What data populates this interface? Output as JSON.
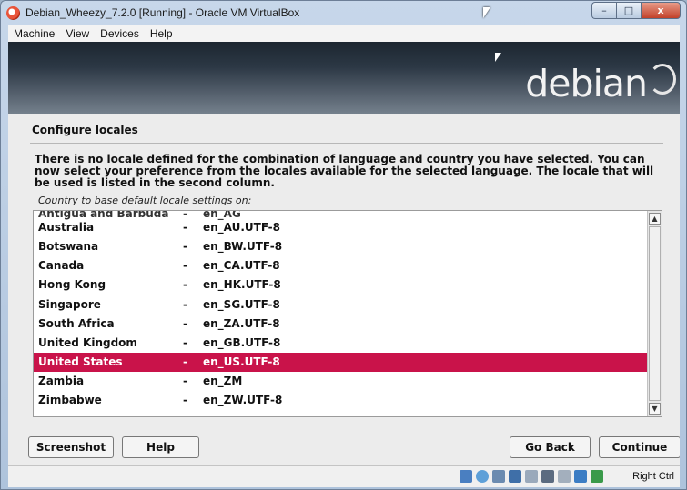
{
  "window": {
    "title": "Debian_Wheezy_7.2.0 [Running] - Oracle VM VirtualBox",
    "controls": {
      "minimize": "–",
      "maximize": "□",
      "close": "x"
    }
  },
  "menubar": [
    "Machine",
    "View",
    "Devices",
    "Help"
  ],
  "installer": {
    "brand": "debian",
    "section_title": "Configure locales",
    "description": "There is no locale defined for the combination of language and country you have selected. You can now select your preference from the locales available for the selected language. The locale that will be used is listed in the second column.",
    "prompt": "Country to base default locale settings on:",
    "partial_row": {
      "country": "Antigua and Barbuda",
      "dash": "-",
      "locale": "en_AG"
    },
    "rows": [
      {
        "country": "Australia",
        "dash": "-",
        "locale": "en_AU.UTF-8"
      },
      {
        "country": "Botswana",
        "dash": "-",
        "locale": "en_BW.UTF-8"
      },
      {
        "country": "Canada",
        "dash": "-",
        "locale": "en_CA.UTF-8"
      },
      {
        "country": "Hong Kong",
        "dash": "-",
        "locale": "en_HK.UTF-8"
      },
      {
        "country": "Singapore",
        "dash": "-",
        "locale": "en_SG.UTF-8"
      },
      {
        "country": "South Africa",
        "dash": "-",
        "locale": "en_ZA.UTF-8"
      },
      {
        "country": "United Kingdom",
        "dash": "-",
        "locale": "en_GB.UTF-8"
      },
      {
        "country": "United States",
        "dash": "-",
        "locale": "en_US.UTF-8",
        "selected": true
      },
      {
        "country": "Zambia",
        "dash": "-",
        "locale": "en_ZM"
      },
      {
        "country": "Zimbabwe",
        "dash": "-",
        "locale": "en_ZW.UTF-8"
      }
    ],
    "scroll_up": "▲",
    "scroll_down": "▼",
    "buttons": {
      "screenshot": "Screenshot",
      "help": "Help",
      "go_back": "Go Back",
      "continue": "Continue"
    },
    "selection_color": "#c9134a"
  },
  "statusbar": {
    "icons": [
      "hard-disk-icon",
      "optical-drive-icon",
      "usb-icon",
      "network-icon",
      "shared-folders-icon",
      "display-icon",
      "video-capture-icon",
      "mouse-integration-icon",
      "keyboard-capture-icon"
    ],
    "host_key": "Right Ctrl"
  }
}
